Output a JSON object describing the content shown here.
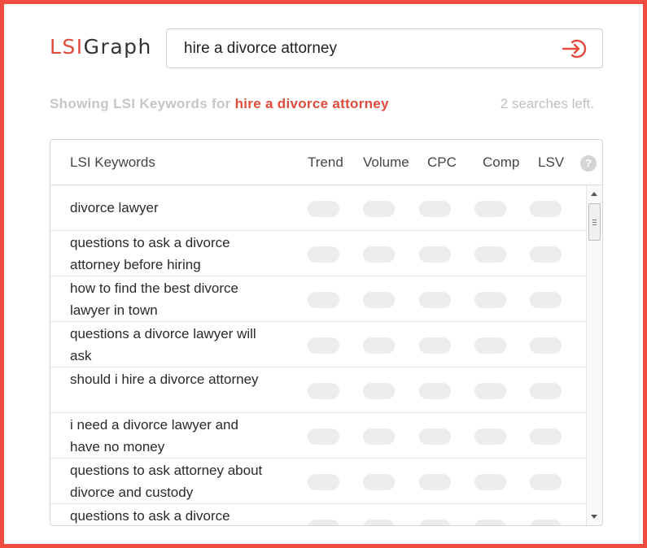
{
  "logo": {
    "lsi": "LSI",
    "graph": "Graph"
  },
  "search": {
    "value": "hire a divorce attorney",
    "go_icon": "sign-in-arrow-icon"
  },
  "summary": {
    "prefix": "Showing LSI Keywords for ",
    "query": "hire a divorce attorney",
    "searches_left": "2 searches left."
  },
  "table": {
    "columns": [
      "LSI Keywords",
      "Trend",
      "Volume",
      "CPC",
      "Comp",
      "LSV"
    ],
    "help_label": "?",
    "rows": [
      {
        "keyword": "divorce lawyer"
      },
      {
        "keyword": "questions to ask a divorce attorney before hiring"
      },
      {
        "keyword": "how to find the best divorce lawyer in town"
      },
      {
        "keyword": "questions a divorce lawyer will ask"
      },
      {
        "keyword": "should i hire a divorce attorney"
      },
      {
        "keyword": "i need a divorce lawyer and have no money"
      },
      {
        "keyword": "questions to ask attorney about divorce and custody"
      },
      {
        "keyword": "questions to ask a divorce"
      }
    ]
  },
  "colors": {
    "accent": "#e14b3b",
    "frame": "#ef4b3f",
    "placeholder_pill": "#ececec"
  }
}
